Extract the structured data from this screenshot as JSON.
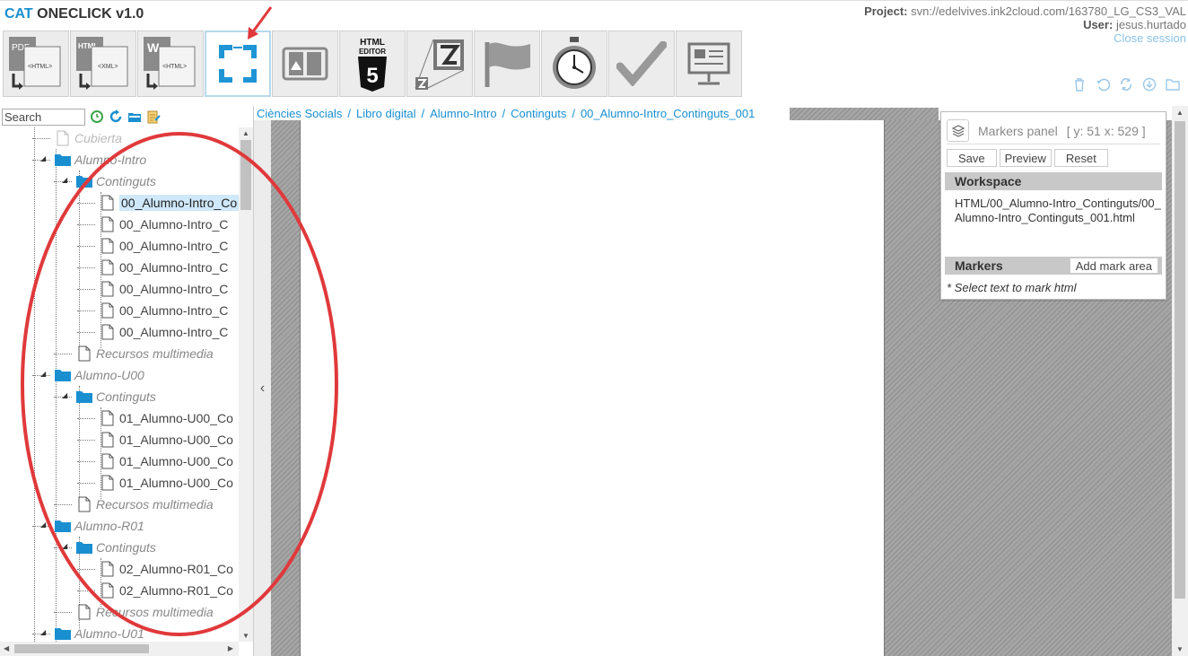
{
  "header": {
    "app_title_prefix": "CAT",
    "app_title_rest": "ONECLICK v1.0",
    "project_label": "Project:",
    "project_value": "svn://edelvives.ink2cloud.com/163780_LG_CS3_VAL",
    "user_label": "User:",
    "user_value": "jesus.hurtado",
    "close_session": "Close session"
  },
  "toolbar": {
    "tools": [
      {
        "icon": "pdf-to-html-icon",
        "label_a": "PDF",
        "label_b": "<HTML>"
      },
      {
        "icon": "html-to-xml-icon",
        "label_a": "HTML",
        "label_b": "<XML>"
      },
      {
        "icon": "word-to-html-icon",
        "label_a": "W",
        "label_b": "<HTML>"
      },
      {
        "icon": "markers-frame-icon"
      },
      {
        "icon": "book-icon"
      },
      {
        "icon": "html5-editor-icon",
        "label_a": "HTML",
        "label_b": "EDITOR",
        "label_c": "5"
      },
      {
        "icon": "zoom-z-icon"
      },
      {
        "icon": "flag-icon"
      },
      {
        "icon": "stopwatch-icon"
      },
      {
        "icon": "checkmark-icon"
      },
      {
        "icon": "presentation-icon"
      }
    ]
  },
  "mini_actions": [
    "trash-icon",
    "undo-icon",
    "sync-icon",
    "download-icon",
    "folder-icon"
  ],
  "tree_panel": {
    "search_placeholder": "Search",
    "collapse_arrow": "‹",
    "nodes": [
      {
        "label": "Cubierta",
        "type": "file",
        "style": "faded",
        "depth": 1
      },
      {
        "label": "Alumno-Intro",
        "type": "folder",
        "depth": 1
      },
      {
        "label": "Continguts",
        "type": "folder",
        "depth": 2
      },
      {
        "label": "00_Alumno-Intro_Co",
        "type": "file",
        "depth": 3,
        "selected": true
      },
      {
        "label": "00_Alumno-Intro_C",
        "type": "file",
        "depth": 3
      },
      {
        "label": "00_Alumno-Intro_C",
        "type": "file",
        "depth": 3
      },
      {
        "label": "00_Alumno-Intro_C",
        "type": "file",
        "depth": 3
      },
      {
        "label": "00_Alumno-Intro_C",
        "type": "file",
        "depth": 3
      },
      {
        "label": "00_Alumno-Intro_C",
        "type": "file",
        "depth": 3
      },
      {
        "label": "00_Alumno-Intro_C",
        "type": "file",
        "depth": 3
      },
      {
        "label": "Recursos multimedia",
        "type": "file",
        "style": "italic",
        "depth": 2
      },
      {
        "label": "Alumno-U00",
        "type": "folder",
        "depth": 1
      },
      {
        "label": "Continguts",
        "type": "folder",
        "depth": 2
      },
      {
        "label": "01_Alumno-U00_Co",
        "type": "file",
        "depth": 3
      },
      {
        "label": "01_Alumno-U00_Co",
        "type": "file",
        "depth": 3
      },
      {
        "label": "01_Alumno-U00_Co",
        "type": "file",
        "depth": 3
      },
      {
        "label": "01_Alumno-U00_Co",
        "type": "file",
        "depth": 3
      },
      {
        "label": "Recursos multimedia",
        "type": "file",
        "style": "italic",
        "depth": 2
      },
      {
        "label": "Alumno-R01",
        "type": "folder",
        "depth": 1
      },
      {
        "label": "Continguts",
        "type": "folder",
        "depth": 2
      },
      {
        "label": "02_Alumno-R01_Co",
        "type": "file",
        "depth": 3
      },
      {
        "label": "02_Alumno-R01_Co",
        "type": "file",
        "depth": 3
      },
      {
        "label": "Recursos multimedia",
        "type": "file",
        "style": "italic",
        "depth": 2
      },
      {
        "label": "Alumno-U01",
        "type": "folder",
        "depth": 1
      }
    ]
  },
  "breadcrumb": {
    "items": [
      "Ciències Socials",
      "Libro digital",
      "Alumno-Intro",
      "Continguts",
      "00_Alumno-Intro_Continguts_001"
    ],
    "separator": "/"
  },
  "markers_panel": {
    "title": "Markers panel",
    "coords": "[ y: 51 x: 529 ]",
    "save": "Save",
    "preview": "Preview",
    "reset": "Reset",
    "workspace_title": "Workspace",
    "workspace_path": "HTML/00_Alumno-Intro_Continguts/00_Alumno-Intro_Continguts_001.html",
    "markers_title": "Markers",
    "add_mark_area": "Add mark area",
    "hint": "* Select text to mark html"
  },
  "colors": {
    "accent": "#1a8fd0",
    "annotation_red": "#e0393b",
    "selection": "#cfe8fa"
  }
}
